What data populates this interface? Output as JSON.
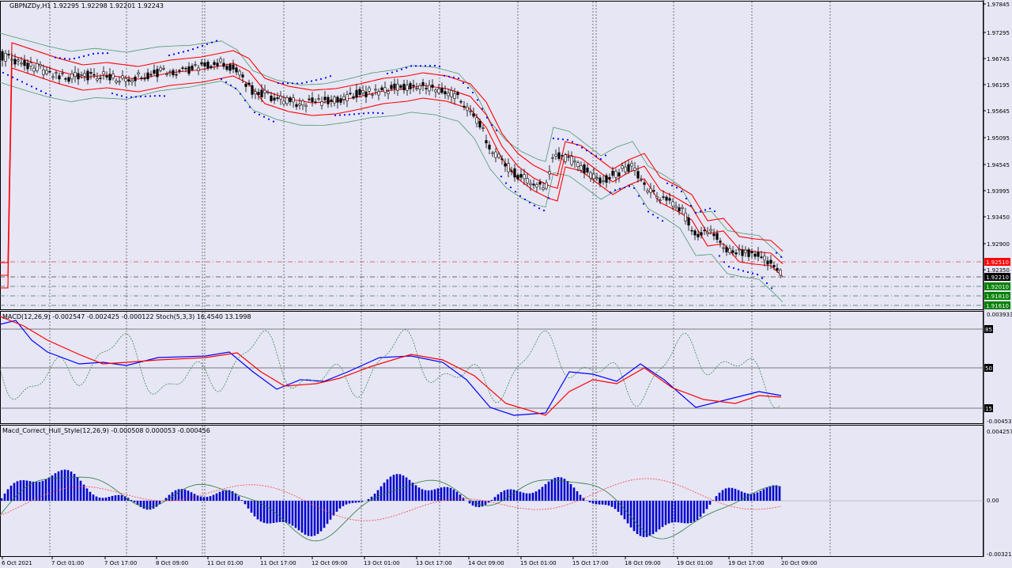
{
  "colors": {
    "background": "#e6e6f5",
    "candle": "#000000",
    "envelope": "#ff0000",
    "bollinger": "#4a9a6e",
    "sar": "#0000ff",
    "macd_main": "#0000ff",
    "macd_signal": "#ff0000",
    "stoch": "#2b7a3b",
    "histogram": "#0000cc",
    "dash_line": "#4a4a4a"
  },
  "main_pane": {
    "header": "GBPNZDy,H1  1.92295 1.92298 1.92201 1.92243",
    "price_ticks": [
      "1.97845",
      "1.97295",
      "1.96745",
      "1.96195",
      "1.95645",
      "1.95095",
      "1.94545",
      "1.93995",
      "1.93450",
      "1.92900",
      "1.92350"
    ],
    "levels": [
      {
        "label": "1.92510",
        "color": "#ff0000",
        "line_color": "#e04040"
      },
      {
        "label": "1.92210",
        "color": "#000000",
        "line_color": "#404040"
      },
      {
        "label": "1.92010",
        "color": "#008000",
        "line_color": "#407060"
      },
      {
        "label": "1.91810",
        "color": "#008000",
        "line_color": "#407060"
      },
      {
        "label": "1.91610",
        "color": "#008000",
        "line_color": "#407060"
      }
    ]
  },
  "osc_pane": {
    "header": "MACD(12,26,9) -0.002547 -0.002425 -0.000122  Stoch(5,3,3) 16.4540 13.1998",
    "top_value": "0.003933",
    "bottom_value": "-0.004533",
    "levels": [
      "85",
      "50",
      "15"
    ]
  },
  "hist_pane": {
    "header": "Macd_Correct_Hull_Style(12,26,9) -0.000508 0.000053 -0.000456",
    "top_value": "0.004257",
    "zero_value": "0.00",
    "bottom_value": "-0.00321"
  },
  "time_axis": [
    "6 Oct 2021",
    "7 Oct 01:00",
    "7 Oct 17:00",
    "8 Oct 09:00",
    "11 Oct 01:00",
    "11 Oct 17:00",
    "12 Oct 09:00",
    "13 Oct 01:00",
    "13 Oct 17:00",
    "14 Oct 09:00",
    "15 Oct 01:00",
    "15 Oct 17:00",
    "18 Oct 09:00",
    "19 Oct 01:00",
    "19 Oct 17:00",
    "20 Oct 09:00"
  ]
}
